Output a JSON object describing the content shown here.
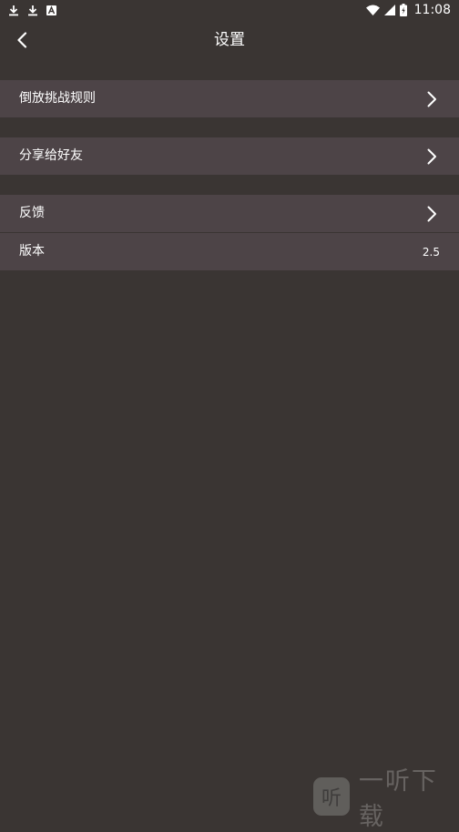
{
  "status_bar": {
    "time": "11:08",
    "left_icons": [
      "download-icon",
      "download-icon",
      "font-a-icon"
    ],
    "right_icons": [
      "wifi-icon",
      "signal-icon",
      "battery-charging-icon"
    ]
  },
  "header": {
    "title": "设置",
    "back_icon": "chevron-left-icon"
  },
  "settings": {
    "rules_label": "倒放挑战规则",
    "share_label": "分享给好友",
    "feedback_label": "反馈",
    "version_label": "版本",
    "version_value": "2.5"
  },
  "watermark": {
    "logo_text": "听",
    "text": "一听下载"
  },
  "colors": {
    "background": "#3a3533",
    "row_background": "#4d4447",
    "text": "#ffffff"
  }
}
